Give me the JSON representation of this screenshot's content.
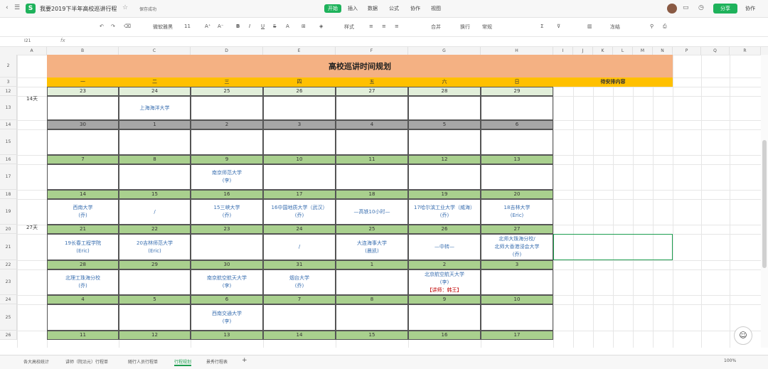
{
  "app": {
    "title": "我要2019下半年高校巡讲行程",
    "save_status": "保存成功",
    "share": "分享",
    "collab": "协作"
  },
  "menu": [
    "开始",
    "插入",
    "数据",
    "公式",
    "协作",
    "视图"
  ],
  "toolbar": {
    "font": "微软雅黑",
    "size": "11",
    "style": "样式",
    "merge": "合并",
    "wrap": "换行",
    "format": "常规",
    "freeze": "冻结"
  },
  "formula_bar": {
    "cell": "I21",
    "fx": "fx"
  },
  "columns": [
    "A",
    "B",
    "C",
    "D",
    "E",
    "F",
    "G",
    "H",
    "I",
    "J",
    "K",
    "L",
    "M",
    "N",
    "P",
    "Q",
    "R"
  ],
  "rows": [
    "2",
    "3",
    "12",
    "13",
    "14",
    "15",
    "16",
    "17",
    "18",
    "19",
    "20",
    "21",
    "22",
    "23",
    "24",
    "25",
    "26"
  ],
  "title": "高校巡讲时间规划",
  "weekdays": [
    "一",
    "二",
    "三",
    "四",
    "五",
    "六",
    "日"
  ],
  "pending_header": "待安排内容",
  "spans": [
    "14天",
    "27天"
  ],
  "weeks": [
    {
      "dates": [
        "23",
        "24",
        "25",
        "26",
        "27",
        "28",
        "29"
      ],
      "events": [
        "",
        "上海海洋大学",
        "",
        "",
        "",
        "",
        ""
      ]
    },
    {
      "dates": [
        "30",
        "1",
        "2",
        "3",
        "4",
        "5",
        "6"
      ],
      "events": [
        "",
        "",
        "",
        "",
        "",
        "",
        ""
      ]
    },
    {
      "dates": [
        "7",
        "8",
        "9",
        "10",
        "11",
        "12",
        "13"
      ],
      "events": [
        "",
        "",
        "南京师范大学\n(李)",
        "",
        "",
        "",
        ""
      ]
    },
    {
      "dates": [
        "14",
        "15",
        "16",
        "17",
        "18",
        "19",
        "20"
      ],
      "events": [
        "西南大学\n(乔)",
        "/",
        "15三峡大学\n(乔)",
        "16中国地质大学（武汉）\n(乔)",
        "—高铁10小时—",
        "17哈尔滨工业大学（威海）\n(乔)",
        "18吉林大学\n(Eric)"
      ]
    },
    {
      "dates": [
        "21",
        "22",
        "23",
        "24",
        "25",
        "26",
        "27"
      ],
      "events": [
        "19长春工程学院\n(Eric)",
        "20吉林师范大学\n(Eric)",
        "",
        "/",
        "大连海事大学\n(晨凯)",
        "—中转—",
        "北师大珠海分校/\n北师大香港浸会大学\n(乔)"
      ]
    },
    {
      "dates": [
        "28",
        "29",
        "30",
        "31",
        "1",
        "2",
        "3"
      ],
      "events": [
        "北理工珠海分校\n(乔)",
        "",
        "南京航空航天大学\n(李)",
        "烟台大学\n(乔)",
        "",
        "北京航空航天大学\n(李)",
        ""
      ]
    },
    {
      "dates": [
        "4",
        "5",
        "6",
        "7",
        "8",
        "9",
        "10"
      ],
      "events": [
        "",
        "",
        "西南交通大学\n(李)",
        "",
        "",
        "",
        ""
      ]
    },
    {
      "dates": [
        "11",
        "12",
        "13",
        "14",
        "15",
        "16",
        "17"
      ],
      "events": []
    }
  ],
  "bjhk_extra": "【讲师：韩王】",
  "sheets": [
    "各大高校统计",
    "讲师（院沿元）行程单",
    "随行人员行程单",
    "行程规划",
    "景秀行程表"
  ],
  "zoom": "100%"
}
